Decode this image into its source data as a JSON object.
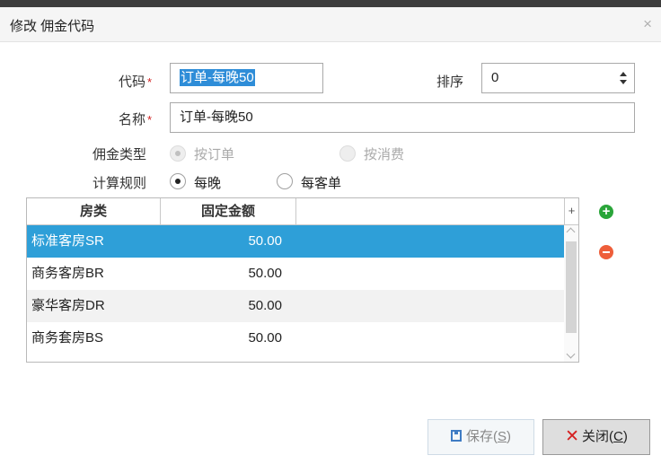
{
  "dialog": {
    "title": "修改 佣金代码",
    "close_glyph": "×"
  },
  "form": {
    "code_label": "代码",
    "required_mark": "*",
    "code_value": "订单-每晚50",
    "sort_label": "排序",
    "sort_value": "0",
    "name_label": "名称",
    "name_value": "订单-每晚50",
    "type_label": "佣金类型",
    "type_options": [
      {
        "label": "按订单",
        "checked": true,
        "disabled": true
      },
      {
        "label": "按消费",
        "checked": false,
        "disabled": true
      }
    ],
    "rule_label": "计算规则",
    "rule_options": [
      {
        "label": "每晚",
        "checked": true,
        "disabled": false
      },
      {
        "label": "每客单",
        "checked": false,
        "disabled": false
      }
    ]
  },
  "grid": {
    "columns": [
      "房类",
      "固定金额"
    ],
    "corner_glyph": "+",
    "rows": [
      {
        "room_type": "标准客房SR",
        "amount": "50.00",
        "selected": true
      },
      {
        "room_type": "商务客房BR",
        "amount": "50.00",
        "selected": false
      },
      {
        "room_type": "豪华客房DR",
        "amount": "50.00",
        "selected": false
      },
      {
        "room_type": "商务套房BS",
        "amount": "50.00",
        "selected": false
      }
    ],
    "add_glyph": "+",
    "add_icon": "plus-circle-icon",
    "remove_icon": "minus-circle-icon"
  },
  "buttons": {
    "save_label": "保存(",
    "save_hotkey": "S",
    "save_suffix": ")",
    "save_icon": "floppy-disk-icon",
    "close_glyph": "✕",
    "close_label": "关闭(",
    "close_hotkey": "C",
    "close_suffix": ")"
  },
  "colors": {
    "selected_row": "#2e9fd8",
    "required": "#d02020",
    "add": "#2aa53a",
    "remove": "#ee5e3a"
  }
}
